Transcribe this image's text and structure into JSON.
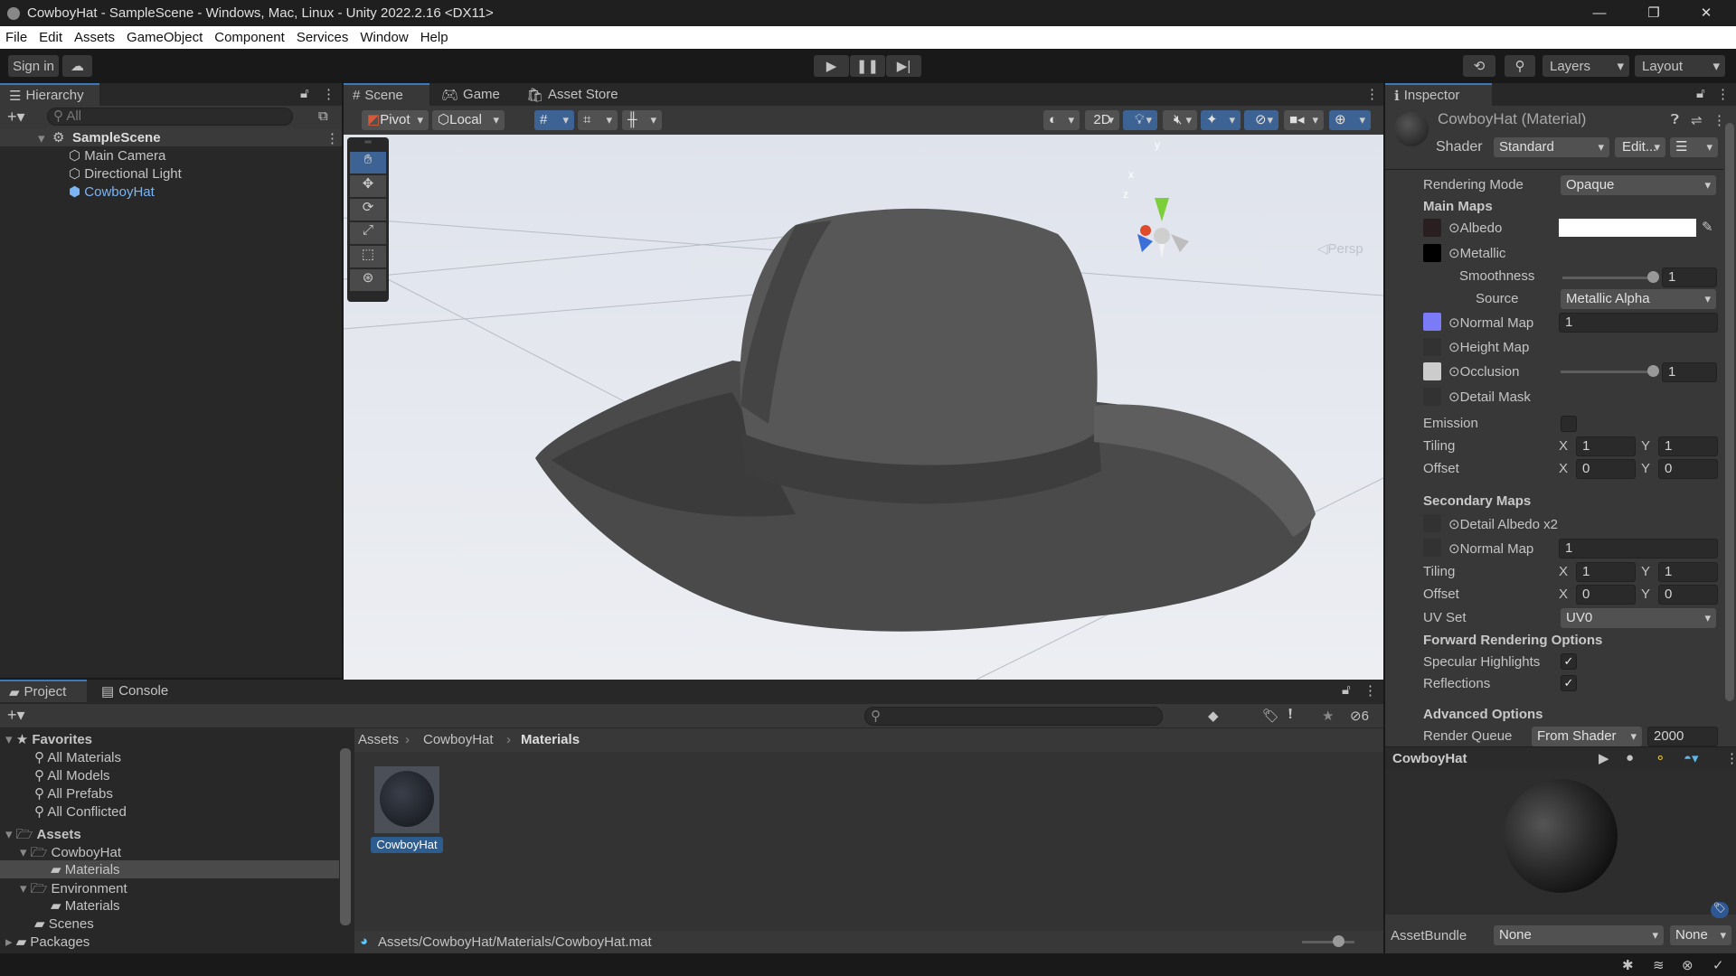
{
  "window": {
    "title": "CowboyHat - SampleScene - Windows, Mac, Linux - Unity 2022.2.16 <DX11>",
    "minimize": "—",
    "maximize": "❐",
    "close": "✕"
  },
  "menu": [
    "File",
    "Edit",
    "Assets",
    "GameObject",
    "Component",
    "Services",
    "Window",
    "Help"
  ],
  "toolbar": {
    "sign_in": "Sign in",
    "layers": "Layers",
    "layout": "Layout"
  },
  "hierarchy": {
    "tab": "Hierarchy",
    "search_placeholder": "All",
    "scene": "SampleScene",
    "items": [
      "Main Camera",
      "Directional Light",
      "CowboyHat"
    ]
  },
  "scene_tabs": [
    "Scene",
    "Game",
    "Asset Store"
  ],
  "scene_toolbar": {
    "pivot": "Pivot",
    "local": "Local",
    "mode_2d": "2D",
    "persp": "Persp",
    "gizmo_axes": [
      "y",
      "x",
      "z"
    ]
  },
  "inspector": {
    "tab": "Inspector",
    "title": "CowboyHat (Material)",
    "shader_label": "Shader",
    "shader": "Standard",
    "edit": "Edit...",
    "rendering_mode_label": "Rendering Mode",
    "rendering_mode": "Opaque",
    "main_maps": "Main Maps",
    "albedo": "Albedo",
    "metallic": "Metallic",
    "smoothness": "Smoothness",
    "smoothness_value": "1",
    "smoothness_fraction": 1.0,
    "source": "Source",
    "source_value": "Metallic Alpha",
    "normal_map": "Normal Map",
    "normal_value": "1",
    "height_map": "Height Map",
    "occlusion": "Occlusion",
    "occlusion_value": "1",
    "occlusion_fraction": 1.0,
    "detail_mask": "Detail Mask",
    "emission": "Emission",
    "tiling": "Tiling",
    "offset": "Offset",
    "x": "X",
    "y": "Y",
    "tiling_x": "1",
    "tiling_y": "1",
    "offset_x": "0",
    "offset_y": "0",
    "secondary_maps": "Secondary Maps",
    "detail_albedo": "Detail Albedo x2",
    "sec_normal_map": "Normal Map",
    "sec_normal_value": "1",
    "sec_tiling_x": "1",
    "sec_tiling_y": "1",
    "sec_offset_x": "0",
    "sec_offset_y": "0",
    "uv_set": "UV Set",
    "uv_set_value": "UV0",
    "forward": "Forward Rendering Options",
    "specular": "Specular Highlights",
    "reflections": "Reflections",
    "check": "✓",
    "advanced": "Advanced Options",
    "render_queue": "Render Queue",
    "render_queue_mode": "From Shader",
    "render_queue_value": "2000",
    "preview_title": "CowboyHat",
    "assetbundle": "AssetBundle",
    "bundle": "None",
    "variant": "None"
  },
  "project": {
    "tabs": [
      "Project",
      "Console"
    ],
    "favorites": "Favorites",
    "fav_items": [
      "All Materials",
      "All Models",
      "All Prefabs",
      "All Conflicted"
    ],
    "assets": "Assets",
    "tree": [
      {
        "label": "CowboyHat",
        "indent": 1,
        "open": true
      },
      {
        "label": "Materials",
        "indent": 2
      },
      {
        "label": "Environment",
        "indent": 1,
        "open": true
      },
      {
        "label": "Materials",
        "indent": 2
      },
      {
        "label": "Scenes",
        "indent": 1
      },
      {
        "label": "Packages",
        "indent": 0
      }
    ],
    "breadcrumb": [
      "Assets",
      "CowboyHat",
      "Materials"
    ],
    "asset_name": "CowboyHat",
    "path": "Assets/CowboyHat/Materials/CowboyHat.mat",
    "hidden_count": "6"
  },
  "colors": {
    "accent": "#3a79bb",
    "selected_text": "#7cb4f5"
  }
}
